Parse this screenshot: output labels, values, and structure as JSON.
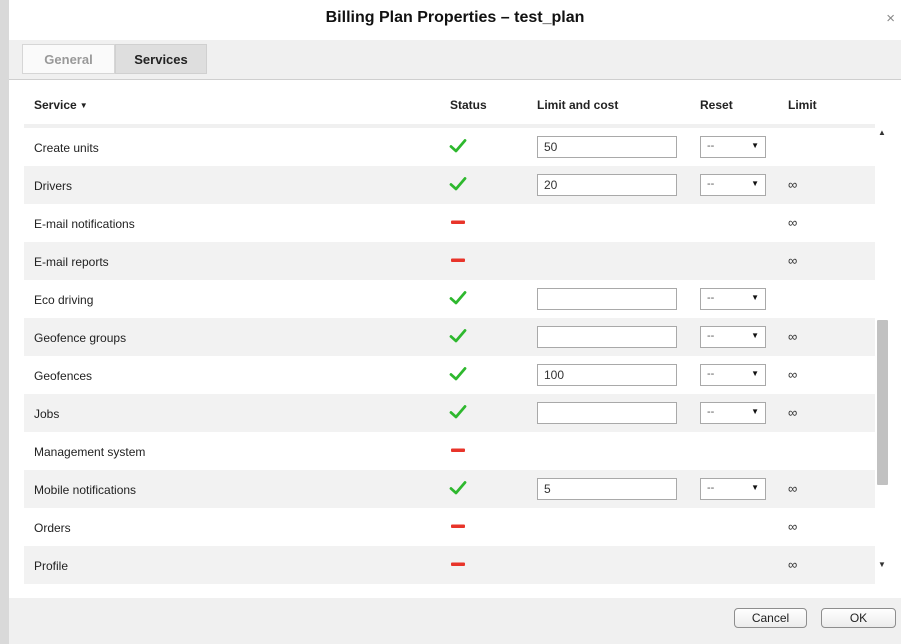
{
  "dialog": {
    "title": "Billing Plan Properties – test_plan",
    "close_icon": "close-icon"
  },
  "tabs": [
    {
      "label": "General",
      "active": false
    },
    {
      "label": "Services",
      "active": true
    }
  ],
  "table": {
    "headers": {
      "service": "Service",
      "status": "Status",
      "limit_cost": "Limit and cost",
      "reset": "Reset",
      "limit": "Limit"
    },
    "sort_icon": "sort-desc-icon",
    "rows": [
      {
        "service": "Create units",
        "status": "enabled",
        "limit_cost": "50",
        "reset": "--",
        "limit": ""
      },
      {
        "service": "Drivers",
        "status": "enabled",
        "limit_cost": "20",
        "reset": "--",
        "limit": "∞"
      },
      {
        "service": "E-mail notifications",
        "status": "disabled",
        "limit": "∞"
      },
      {
        "service": "E-mail reports",
        "status": "disabled",
        "limit": "∞"
      },
      {
        "service": "Eco driving",
        "status": "enabled",
        "limit_cost": "",
        "reset": "--",
        "limit": ""
      },
      {
        "service": "Geofence groups",
        "status": "enabled",
        "limit_cost": "",
        "reset": "--",
        "limit": "∞"
      },
      {
        "service": "Geofences",
        "status": "enabled",
        "limit_cost": "100",
        "reset": "--",
        "limit": "∞"
      },
      {
        "service": "Jobs",
        "status": "enabled",
        "limit_cost": "",
        "reset": "--",
        "limit": "∞"
      },
      {
        "service": "Management system",
        "status": "disabled",
        "limit": ""
      },
      {
        "service": "Mobile notifications",
        "status": "enabled",
        "limit_cost": "5",
        "reset": "--",
        "limit": "∞"
      },
      {
        "service": "Orders",
        "status": "disabled",
        "limit": "∞"
      },
      {
        "service": "Profile",
        "status": "disabled",
        "limit": "∞"
      }
    ]
  },
  "colors": {
    "enabled": "#2eb82e",
    "disabled": "#e8342a"
  },
  "footer": {
    "cancel_label": "Cancel",
    "ok_label": "OK"
  }
}
